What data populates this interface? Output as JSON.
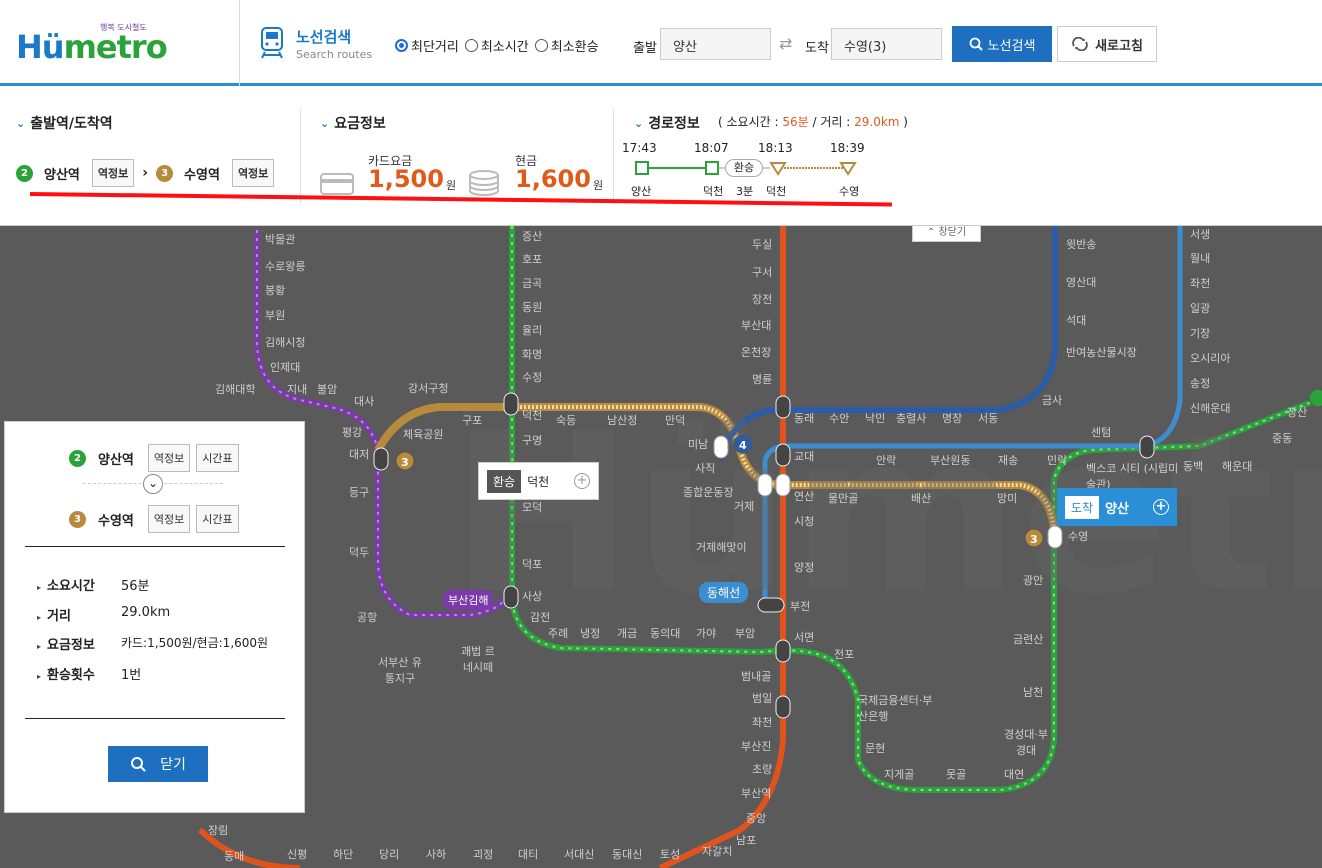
{
  "header": {
    "logo_tagline": "행복",
    "logo_tagline_small": "도시철도",
    "logo_name_prefix": "Hü",
    "logo_name_suffix": "metro",
    "search_title": "노선검색",
    "search_subtitle": "Search routes",
    "radio_options": [
      {
        "label": "최단거리",
        "selected": true
      },
      {
        "label": "최소시간",
        "selected": false
      },
      {
        "label": "최소환승",
        "selected": false
      }
    ],
    "departure_label": "출발",
    "departure_value": "양산",
    "arrival_label": "도착",
    "arrival_value": "수영(3)",
    "search_button": "노선검색",
    "refresh_button": "새로고침"
  },
  "info": {
    "stations_title": "출발역/도착역",
    "from_line": "2",
    "from_station": "양산역",
    "from_info": "역정보",
    "to_line": "3",
    "to_station": "수영역",
    "to_info": "역정보",
    "fare_title": "요금정보",
    "card_label": "카드요금",
    "card_value": "1,500",
    "cash_label": "현금",
    "cash_value": "1,600",
    "unit": "원",
    "route_title": "경로정보",
    "route_summary_prefix": "( 소요시간 :",
    "route_time": "56분",
    "route_dist_label": "/ 거리 :",
    "route_dist": "29.0km",
    "route_summary_suffix": ")",
    "times": [
      "17:43",
      "18:07",
      "18:13",
      "18:39"
    ],
    "transfer": "환승",
    "transfer_time": "3분",
    "route_stations": [
      "양산",
      "덕천",
      "덕천",
      "수영"
    ]
  },
  "map": {
    "collapse": "창닫기",
    "transfer_popup_tag": "환승",
    "transfer_popup_station": "덕천",
    "arrive_tag": "도착",
    "arrive_station": "양산",
    "line_badge_busan_gimhae": "부산김해",
    "line_badge_donghae": "동해선",
    "station_labels": [
      "박물관",
      "수로왕릉",
      "봉황",
      "부원",
      "김해시청",
      "인제대",
      "김해대학",
      "지내",
      "불암",
      "대사",
      "평강",
      "대저",
      "등구",
      "덕두",
      "공항",
      "서부산 유통지구",
      "증산",
      "호포",
      "금곡",
      "동원",
      "율리",
      "화명",
      "수정",
      "덕천",
      "구명",
      "구남",
      "모덕",
      "덕포",
      "사상",
      "감전",
      "주례",
      "냉정",
      "개금",
      "동의대",
      "가야",
      "부암",
      "강서구청",
      "체육공원",
      "구포",
      "숙등",
      "남산정",
      "만덕",
      "미남",
      "사직",
      "종합운동장",
      "거제",
      "거제해맞이",
      "연산",
      "시청",
      "양정",
      "부전",
      "서면",
      "두실",
      "구서",
      "장전",
      "부산대",
      "온천장",
      "명륜",
      "동래",
      "교대",
      "수안",
      "낙민",
      "충렬사",
      "명장",
      "서동",
      "반여농산물시장",
      "석대",
      "영산대",
      "윗반송",
      "금사",
      "물만골",
      "배산",
      "망미",
      "수영",
      "광안",
      "금련산",
      "남천",
      "경성대·부경대",
      "대연",
      "못골",
      "지게골",
      "문현",
      "국제금융센터·부산은행",
      "전포",
      "범내골",
      "범일",
      "좌천",
      "부산진",
      "초량",
      "부산역",
      "중앙",
      "남포",
      "자갈치",
      "토성",
      "동대신",
      "서대신",
      "대티",
      "괴정",
      "사하",
      "당리",
      "하단",
      "신평",
      "동매",
      "장림",
      "센텀",
      "벡스코 시티 (시립미술관)",
      "동백",
      "해운대",
      "중동",
      "장산",
      "민락",
      "재송",
      "안락",
      "부산원동",
      "서생",
      "월내",
      "좌천",
      "일광",
      "기장",
      "오시리아",
      "송정",
      "신해운대",
      "괘법 르네시떼",
      "사직"
    ]
  },
  "panel": {
    "from_line": "2",
    "from_station": "양산역",
    "from_info": "역정보",
    "from_timetable": "시간표",
    "to_line": "3",
    "to_station": "수영역",
    "to_info": "역정보",
    "to_timetable": "시간표",
    "rows": [
      {
        "key": "소요시간",
        "value": "56분"
      },
      {
        "key": "거리",
        "value": "29.0km"
      },
      {
        "key": "요금정보",
        "value": "카드:1,500원/현금:1,600원"
      },
      {
        "key": "환승횟수",
        "value": "1번"
      }
    ],
    "close_button": "닫기"
  },
  "colors": {
    "line1": "#e0531c",
    "line2": "#2ba33a",
    "line3": "#b88b3c",
    "line4": "#2a5ca8",
    "bgl": "#7a3aa8",
    "accent": "#1e6fbf",
    "fare": "#e05a1a"
  }
}
